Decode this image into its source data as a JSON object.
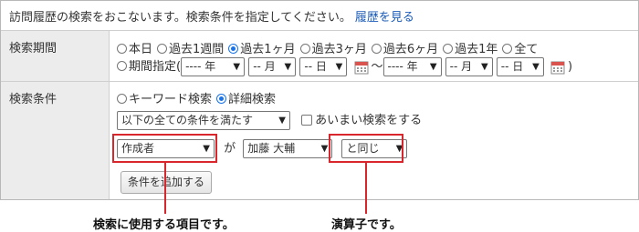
{
  "intro": {
    "text": "訪問履歴の検索をおこないます。検索条件を指定してください。",
    "link": "履歴を見る"
  },
  "period": {
    "label": "検索期間",
    "options": [
      "本日",
      "過去1週間",
      "過去1ヶ月",
      "過去3ヶ月",
      "過去6ヶ月",
      "過去1年",
      "全て"
    ],
    "selected": "過去1ヶ月",
    "custom_label": "期間指定(",
    "from": {
      "year": "---- 年",
      "month": "-- 月",
      "day": "-- 日"
    },
    "separator": "～",
    "to": {
      "year": "---- 年",
      "month": "-- 月",
      "day": "-- 日"
    },
    "close": ")"
  },
  "condition": {
    "label": "検索条件",
    "mode_options": [
      "キーワード検索",
      "詳細検索"
    ],
    "mode_selected": "詳細検索",
    "match_select": "以下の全ての条件を満たす",
    "fuzzy_label": "あいまい検索をする",
    "fuzzy_checked": false,
    "item_select": "作成者",
    "particle": "が",
    "value_select": "加藤 大輔",
    "operator_select": "と同じ",
    "add_button": "条件を追加する"
  },
  "annotations": {
    "item_note": "検索に使用する項目です。",
    "operator_note": "演算子です。"
  },
  "colors": {
    "accent": "#1a73e8",
    "link": "#1a5bb7",
    "highlight": "#d9262c",
    "label_bg": "#ececec"
  }
}
